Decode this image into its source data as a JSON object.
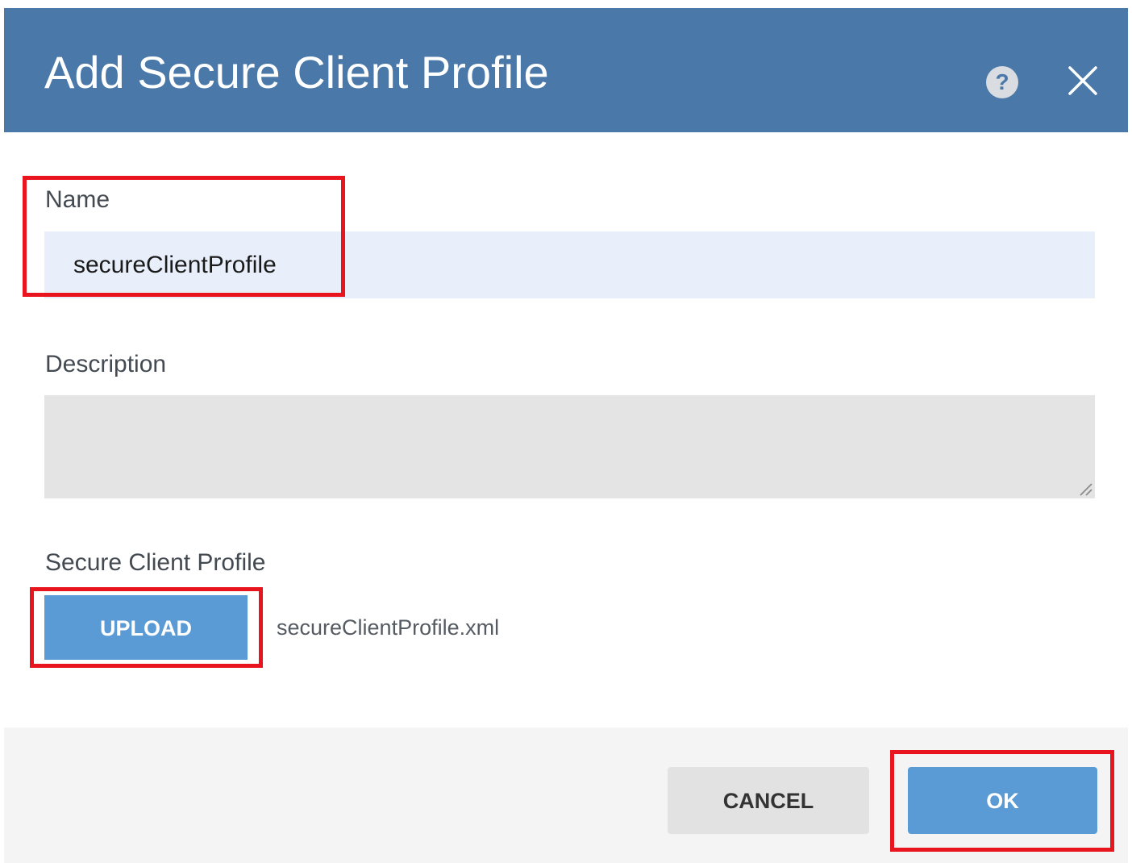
{
  "dialog": {
    "title": "Add Secure Client Profile",
    "help_icon": "help-icon",
    "help_glyph": "?",
    "close_icon": "close-icon"
  },
  "form": {
    "name_label": "Name",
    "name_value": "secureClientProfile",
    "description_label": "Description",
    "description_value": "",
    "profile_label": "Secure Client Profile",
    "upload_label": "UPLOAD",
    "uploaded_file": "secureClientProfile.xml"
  },
  "footer": {
    "cancel_label": "CANCEL",
    "ok_label": "OK"
  },
  "colors": {
    "header": "#4a78a8",
    "primary_button": "#5b9bd5",
    "highlight": "#e8141e",
    "name_field_bg": "#e8effa",
    "description_field_bg": "#e4e4e4"
  }
}
